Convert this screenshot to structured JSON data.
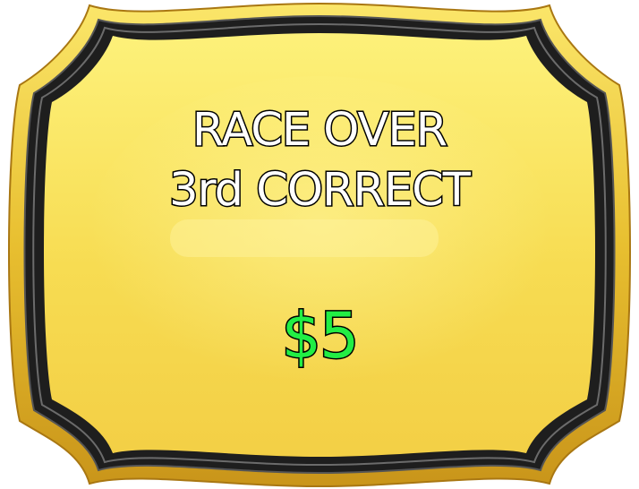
{
  "plaque": {
    "line1": "RACE OVER",
    "line2": "3rd CORRECT",
    "prize": "$5"
  },
  "colors": {
    "gold_light": "#fdf17a",
    "gold_mid": "#f7dc52",
    "gold_dark": "#d9a920",
    "rim": "#1e1e1e",
    "text_fill": "#ffffff",
    "text_outline": "#000000",
    "prize_fill": "#22ee44"
  }
}
